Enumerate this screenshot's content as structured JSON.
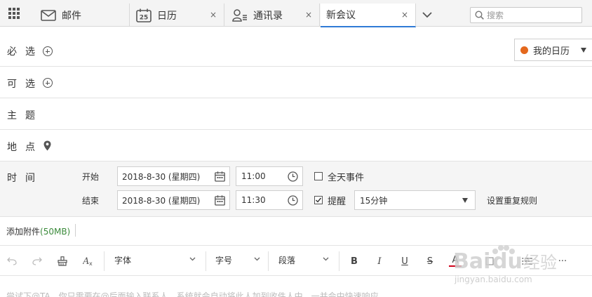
{
  "tabs": [
    {
      "label": "邮件",
      "icon": "mail-icon"
    },
    {
      "label": "日历",
      "icon": "calendar-icon",
      "icon_text": "25",
      "close": "×"
    },
    {
      "label": "通讯录",
      "icon": "contacts-icon",
      "close": "×"
    },
    {
      "label": "新会议",
      "active": true,
      "close": "×"
    }
  ],
  "search": {
    "placeholder": "搜索"
  },
  "form": {
    "required": {
      "label": "必选"
    },
    "optional": {
      "label": "可选"
    },
    "subject": {
      "label": "主题",
      "value": ""
    },
    "location": {
      "label": "地点",
      "value": ""
    },
    "calendar": {
      "label": "我的日历",
      "dot_color": "#e4681d"
    },
    "time": {
      "label": "时间",
      "start": {
        "label": "开始",
        "date": "2018-8-30 (星期四)",
        "time": "11:00"
      },
      "end": {
        "label": "结束",
        "date": "2018-8-30 (星期四)",
        "time": "11:30"
      },
      "all_day": {
        "label": "全天事件",
        "checked": false
      },
      "reminder": {
        "label": "提醒",
        "checked": true,
        "value": "15分钟"
      },
      "repeat_rule": "设置重复规则"
    },
    "attachment": {
      "label": "添加附件",
      "limit": "(50MB)"
    }
  },
  "toolbar": {
    "font_label": "字体",
    "size_label": "字号",
    "paragraph_label": "段落",
    "bold": "B",
    "italic": "I",
    "underline": "U",
    "strike": "S",
    "font_color": "A",
    "more": "···"
  },
  "body_hint": "尝试下@TA，你只需要在@后面输入联系人，系统就会自动将此人加到收件人中，一并会中快速响应",
  "watermark": {
    "brand": "Baidu经验",
    "url": "jingyan.baidu.com"
  },
  "colors": {
    "accent": "#2f7bd6",
    "calendar_dot": "#e4681d",
    "attach_limit": "#3a8a3a"
  }
}
